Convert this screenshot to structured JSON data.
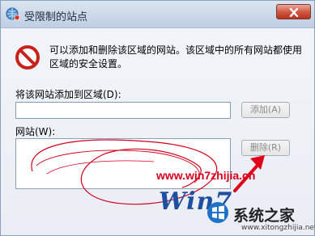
{
  "window": {
    "title": "受限制的站点",
    "icons": {
      "title": "globe-shield-icon",
      "warning": "no-entry-icon",
      "close": "close-icon"
    }
  },
  "message": "可以添加和删除该区域的网站。该区域中的所有网站都使用区域的安全设置。",
  "add_site": {
    "label": "将该网站添加到区域(D):",
    "value": "",
    "add_button": "添加(A)"
  },
  "sites": {
    "label": "网站(W):",
    "items": [],
    "remove_button": "删除(R)"
  },
  "watermark": {
    "url": "www.win7zhijia.cn",
    "word": "Win7",
    "name": "系统之家",
    "domain": "www.xitongzhijia.net"
  },
  "colors": {
    "title_bar": "#c9d7e8",
    "annotation": "#d6001c",
    "close": "#c8452f"
  }
}
